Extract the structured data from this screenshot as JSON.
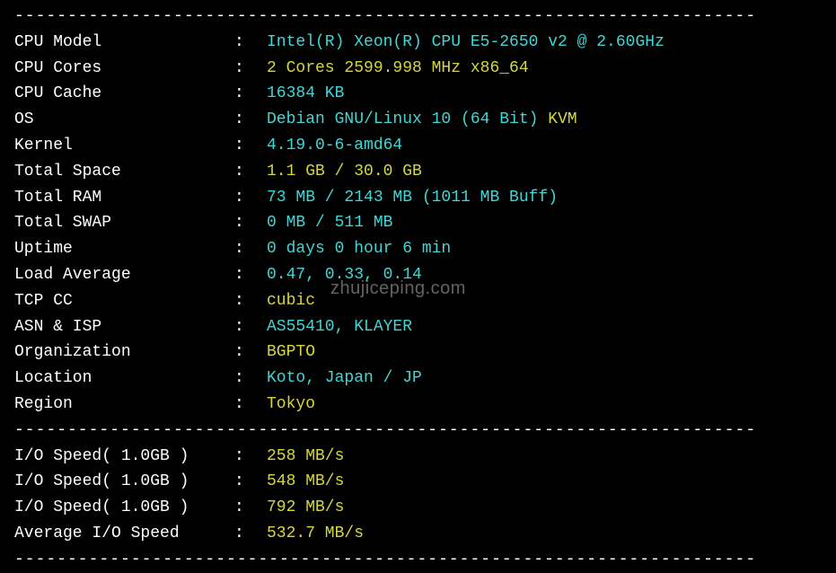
{
  "divider": "----------------------------------------------------------------------",
  "watermark": "zhujiceping.com",
  "rows": [
    {
      "label": "CPU Model",
      "parts": [
        {
          "text": "Intel(R) Xeon(R) CPU E5-2650 v2 @ 2.60GHz",
          "class": "cyan"
        }
      ]
    },
    {
      "label": "CPU Cores",
      "parts": [
        {
          "text": "2 Cores 2599.998 MHz x86_64",
          "class": "yellow"
        }
      ]
    },
    {
      "label": "CPU Cache",
      "parts": [
        {
          "text": "16384 KB",
          "class": "cyan"
        }
      ]
    },
    {
      "label": "OS",
      "parts": [
        {
          "text": "Debian GNU/Linux 10 (64 Bit) ",
          "class": "cyan"
        },
        {
          "text": "KVM",
          "class": "yellow"
        }
      ]
    },
    {
      "label": "Kernel",
      "parts": [
        {
          "text": "4.19.0-6-amd64",
          "class": "cyan"
        }
      ]
    },
    {
      "label": "Total Space",
      "parts": [
        {
          "text": "1.1 GB / 30.0 GB",
          "class": "yellow"
        }
      ]
    },
    {
      "label": "Total RAM",
      "parts": [
        {
          "text": "73 MB / 2143 MB (1011 MB Buff)",
          "class": "cyan"
        }
      ]
    },
    {
      "label": "Total SWAP",
      "parts": [
        {
          "text": "0 MB / 511 MB",
          "class": "cyan"
        }
      ]
    },
    {
      "label": "Uptime",
      "parts": [
        {
          "text": "0 days 0 hour 6 min",
          "class": "cyan"
        }
      ]
    },
    {
      "label": "Load Average",
      "parts": [
        {
          "text": "0.47, 0.33, 0.14",
          "class": "cyan"
        }
      ]
    },
    {
      "label": "TCP CC",
      "parts": [
        {
          "text": "cubic",
          "class": "yellow"
        }
      ]
    },
    {
      "label": "ASN & ISP",
      "parts": [
        {
          "text": "AS55410, KLAYER",
          "class": "cyan"
        }
      ]
    },
    {
      "label": "Organization",
      "parts": [
        {
          "text": "BGPTO",
          "class": "yellow"
        }
      ]
    },
    {
      "label": "Location",
      "parts": [
        {
          "text": "Koto, Japan / JP",
          "class": "cyan"
        }
      ]
    },
    {
      "label": "Region",
      "parts": [
        {
          "text": "Tokyo",
          "class": "yellow"
        }
      ]
    }
  ],
  "io_rows": [
    {
      "label": "I/O Speed( 1.0GB )",
      "parts": [
        {
          "text": "258 MB/s",
          "class": "yellow"
        }
      ]
    },
    {
      "label": "I/O Speed( 1.0GB )",
      "parts": [
        {
          "text": "548 MB/s",
          "class": "yellow"
        }
      ]
    },
    {
      "label": "I/O Speed( 1.0GB )",
      "parts": [
        {
          "text": "792 MB/s",
          "class": "yellow"
        }
      ]
    },
    {
      "label": "Average I/O Speed",
      "parts": [
        {
          "text": "532.7 MB/s",
          "class": "yellow"
        }
      ]
    }
  ]
}
